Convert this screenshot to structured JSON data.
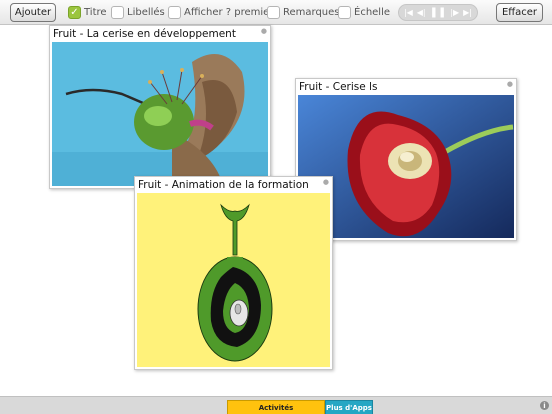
{
  "toolbar": {
    "add_label": "Ajouter",
    "clear_label": "Effacer",
    "options": [
      {
        "label": "Titre",
        "checked": true
      },
      {
        "label": "Libellés",
        "checked": false
      },
      {
        "label": "Afficher ? premier",
        "checked": false
      },
      {
        "label": "Remarques",
        "checked": false
      },
      {
        "label": "Échelle",
        "checked": false
      }
    ],
    "media_controls": [
      "first-icon",
      "prev-icon",
      "pause-icon",
      "next-icon",
      "last-icon"
    ]
  },
  "cards": [
    {
      "title": "Fruit - La cerise en développement",
      "image": "developing-cherry-photo"
    },
    {
      "title": "Fruit - Cerise ls",
      "image": "cherry-section-photo"
    },
    {
      "title": "Fruit - Animation de la formation",
      "image": "fruit-formation-animation"
    }
  ],
  "bottom": {
    "tab_activities": "Activités",
    "tab_apps": "Plus d'Apps",
    "info_label": "i"
  },
  "colors": {
    "checked": "#9bc53d",
    "activities": "#ffc20e",
    "apps": "#26a7c4"
  }
}
